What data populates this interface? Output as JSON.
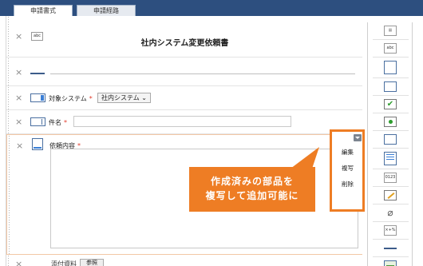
{
  "tabs": [
    {
      "label": "申請書式",
      "active": true
    },
    {
      "label": "申請経路",
      "active": false
    }
  ],
  "form": {
    "title": "社内システム変更依頼書",
    "title_icon_text": "abc",
    "fields": {
      "target_system": {
        "label": "対象システム",
        "required_mark": "*",
        "selected": "社内システム ⌄"
      },
      "subject": {
        "label": "件名",
        "required_mark": "*",
        "value": ""
      },
      "request_details": {
        "label": "依頼内容",
        "required_mark": "*",
        "value": ""
      }
    },
    "bottom_row": {
      "label": "添付資料",
      "button": "参照"
    }
  },
  "context_menu": {
    "items": [
      "編集",
      "複写",
      "削除"
    ]
  },
  "callout": {
    "line1": "作成済みの部品を",
    "line2": "複写して追加可能に"
  },
  "palette": {
    "text_icon_label": "abc",
    "number_icon_label": "0123",
    "calc_icon_label": "×+%"
  },
  "colors": {
    "tab_bar": "#2d4f7f",
    "accent_orange": "#ee7d24",
    "required": "#e03a2a"
  }
}
